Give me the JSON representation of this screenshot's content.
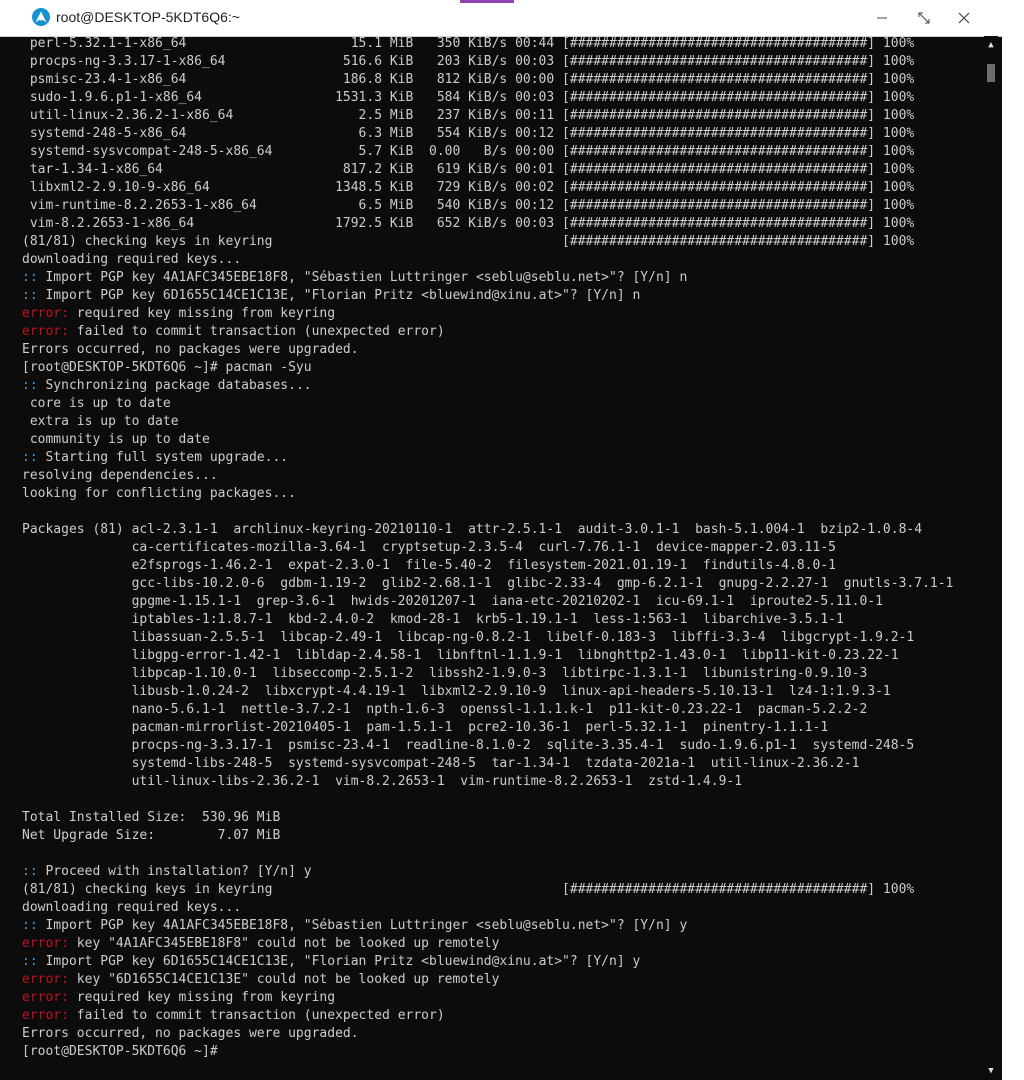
{
  "window": {
    "title": "root@DESKTOP-5KDT6Q6:~",
    "accent_color": "#8e44ad",
    "icon": "arch-linux-icon"
  },
  "colors": {
    "background": "#0c0c0c",
    "text": "#cccccc",
    "error": "#c50f1f",
    "prefix": "#3a96dd"
  },
  "terminal": {
    "lines": [
      {
        "p": "",
        "t": " perl-5.32.1-1-x86_64                     15.1 MiB   350 KiB/s 00:44 [######################################] 100%"
      },
      {
        "p": "",
        "t": " procps-ng-3.3.17-1-x86_64               516.6 KiB   203 KiB/s 00:03 [######################################] 100%"
      },
      {
        "p": "",
        "t": " psmisc-23.4-1-x86_64                    186.8 KiB   812 KiB/s 00:00 [######################################] 100%"
      },
      {
        "p": "",
        "t": " sudo-1.9.6.p1-1-x86_64                 1531.3 KiB   584 KiB/s 00:03 [######################################] 100%"
      },
      {
        "p": "",
        "t": " util-linux-2.36.2-1-x86_64                2.5 MiB   237 KiB/s 00:11 [######################################] 100%"
      },
      {
        "p": "",
        "t": " systemd-248-5-x86_64                      6.3 MiB   554 KiB/s 00:12 [######################################] 100%"
      },
      {
        "p": "",
        "t": " systemd-sysvcompat-248-5-x86_64           5.7 KiB  0.00   B/s 00:00 [######################################] 100%"
      },
      {
        "p": "",
        "t": " tar-1.34-1-x86_64                       817.2 KiB   619 KiB/s 00:01 [######################################] 100%"
      },
      {
        "p": "",
        "t": " libxml2-2.9.10-9-x86_64                1348.5 KiB   729 KiB/s 00:02 [######################################] 100%"
      },
      {
        "p": "",
        "t": " vim-runtime-8.2.2653-1-x86_64             6.5 MiB   540 KiB/s 00:12 [######################################] 100%"
      },
      {
        "p": "",
        "t": " vim-8.2.2653-1-x86_64                  1792.5 KiB   652 KiB/s 00:03 [######################################] 100%"
      },
      {
        "p": "",
        "t": "(81/81) checking keys in keyring                                     [######################################] 100%"
      },
      {
        "p": "",
        "t": "downloading required keys..."
      },
      {
        "p": ":: ",
        "t": "Import PGP key 4A1AFC345EBE18F8, \"Sébastien Luttringer <seblu@seblu.net>\"? [Y/n] n"
      },
      {
        "p": ":: ",
        "t": "Import PGP key 6D1655C14CE1C13E, \"Florian Pritz <bluewind@xinu.at>\"? [Y/n] n"
      },
      {
        "e": "error: ",
        "t": "required key missing from keyring"
      },
      {
        "e": "error: ",
        "t": "failed to commit transaction (unexpected error)"
      },
      {
        "p": "",
        "t": "Errors occurred, no packages were upgraded."
      },
      {
        "p": "",
        "t": "[root@DESKTOP-5KDT6Q6 ~]# pacman -Syu"
      },
      {
        "p": ":: ",
        "t": "Synchronizing package databases..."
      },
      {
        "p": "",
        "t": " core is up to date"
      },
      {
        "p": "",
        "t": " extra is up to date"
      },
      {
        "p": "",
        "t": " community is up to date"
      },
      {
        "p": ":: ",
        "t": "Starting full system upgrade..."
      },
      {
        "p": "",
        "t": "resolving dependencies..."
      },
      {
        "p": "",
        "t": "looking for conflicting packages..."
      },
      {
        "p": "",
        "t": ""
      },
      {
        "p": "",
        "t": "Packages (81) acl-2.3.1-1  archlinux-keyring-20210110-1  attr-2.5.1-1  audit-3.0.1-1  bash-5.1.004-1  bzip2-1.0.8-4"
      },
      {
        "p": "",
        "t": "              ca-certificates-mozilla-3.64-1  cryptsetup-2.3.5-4  curl-7.76.1-1  device-mapper-2.03.11-5"
      },
      {
        "p": "",
        "t": "              e2fsprogs-1.46.2-1  expat-2.3.0-1  file-5.40-2  filesystem-2021.01.19-1  findutils-4.8.0-1"
      },
      {
        "p": "",
        "t": "              gcc-libs-10.2.0-6  gdbm-1.19-2  glib2-2.68.1-1  glibc-2.33-4  gmp-6.2.1-1  gnupg-2.2.27-1  gnutls-3.7.1-1"
      },
      {
        "p": "",
        "t": "              gpgme-1.15.1-1  grep-3.6-1  hwids-20201207-1  iana-etc-20210202-1  icu-69.1-1  iproute2-5.11.0-1"
      },
      {
        "p": "",
        "t": "              iptables-1:1.8.7-1  kbd-2.4.0-2  kmod-28-1  krb5-1.19.1-1  less-1:563-1  libarchive-3.5.1-1"
      },
      {
        "p": "",
        "t": "              libassuan-2.5.5-1  libcap-2.49-1  libcap-ng-0.8.2-1  libelf-0.183-3  libffi-3.3-4  libgcrypt-1.9.2-1"
      },
      {
        "p": "",
        "t": "              libgpg-error-1.42-1  libldap-2.4.58-1  libnftnl-1.1.9-1  libnghttp2-1.43.0-1  libp11-kit-0.23.22-1"
      },
      {
        "p": "",
        "t": "              libpcap-1.10.0-1  libseccomp-2.5.1-2  libssh2-1.9.0-3  libtirpc-1.3.1-1  libunistring-0.9.10-3"
      },
      {
        "p": "",
        "t": "              libusb-1.0.24-2  libxcrypt-4.4.19-1  libxml2-2.9.10-9  linux-api-headers-5.10.13-1  lz4-1:1.9.3-1"
      },
      {
        "p": "",
        "t": "              nano-5.6.1-1  nettle-3.7.2-1  npth-1.6-3  openssl-1.1.1.k-1  p11-kit-0.23.22-1  pacman-5.2.2-2"
      },
      {
        "p": "",
        "t": "              pacman-mirrorlist-20210405-1  pam-1.5.1-1  pcre2-10.36-1  perl-5.32.1-1  pinentry-1.1.1-1"
      },
      {
        "p": "",
        "t": "              procps-ng-3.3.17-1  psmisc-23.4-1  readline-8.1.0-2  sqlite-3.35.4-1  sudo-1.9.6.p1-1  systemd-248-5"
      },
      {
        "p": "",
        "t": "              systemd-libs-248-5  systemd-sysvcompat-248-5  tar-1.34-1  tzdata-2021a-1  util-linux-2.36.2-1"
      },
      {
        "p": "",
        "t": "              util-linux-libs-2.36.2-1  vim-8.2.2653-1  vim-runtime-8.2.2653-1  zstd-1.4.9-1"
      },
      {
        "p": "",
        "t": ""
      },
      {
        "p": "",
        "t": "Total Installed Size:  530.96 MiB"
      },
      {
        "p": "",
        "t": "Net Upgrade Size:        7.07 MiB"
      },
      {
        "p": "",
        "t": ""
      },
      {
        "p": ":: ",
        "t": "Proceed with installation? [Y/n] y"
      },
      {
        "p": "",
        "t": "(81/81) checking keys in keyring                                     [######################################] 100%"
      },
      {
        "p": "",
        "t": "downloading required keys..."
      },
      {
        "p": ":: ",
        "t": "Import PGP key 4A1AFC345EBE18F8, \"Sébastien Luttringer <seblu@seblu.net>\"? [Y/n] y"
      },
      {
        "e": "error: ",
        "t": "key \"4A1AFC345EBE18F8\" could not be looked up remotely"
      },
      {
        "p": ":: ",
        "t": "Import PGP key 6D1655C14CE1C13E, \"Florian Pritz <bluewind@xinu.at>\"? [Y/n] y"
      },
      {
        "e": "error: ",
        "t": "key \"6D1655C14CE1C13E\" could not be looked up remotely"
      },
      {
        "e": "error: ",
        "t": "required key missing from keyring"
      },
      {
        "e": "error: ",
        "t": "failed to commit transaction (unexpected error)"
      },
      {
        "p": "",
        "t": "Errors occurred, no packages were upgraded."
      },
      {
        "p": "",
        "t": "[root@DESKTOP-5KDT6Q6 ~]#"
      }
    ]
  },
  "scrollbar": {
    "up_icon": "▲",
    "down_icon": "▼"
  }
}
